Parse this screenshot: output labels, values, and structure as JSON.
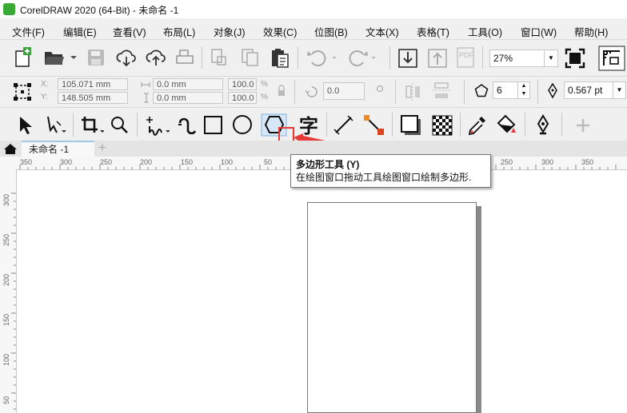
{
  "window": {
    "title": "CorelDRAW 2020 (64-Bit) - 未命名 -1"
  },
  "menu": [
    "文件(F)",
    "编辑(E)",
    "查看(V)",
    "布局(L)",
    "对象(J)",
    "效果(C)",
    "位图(B)",
    "文本(X)",
    "表格(T)",
    "工具(O)",
    "窗口(W)",
    "帮助(H)"
  ],
  "toolbar": {
    "zoom": "27%"
  },
  "property_bar": {
    "x_label": "X:",
    "y_label": "Y:",
    "x_value": "105.071 mm",
    "y_value": "148.505 mm",
    "width_value": "0.0 mm",
    "height_value": "0.0 mm",
    "scale_w": "100.0",
    "scale_h": "100.0",
    "scale_unit": "%",
    "rotation": "0.0",
    "sides": "6",
    "outline_width": "0.567 pt"
  },
  "document_tab": {
    "label": "未命名 -1",
    "add_symbol": "+"
  },
  "ruler": {
    "h_labels": [
      "350",
      "300",
      "250",
      "200",
      "150",
      "100",
      "50",
      "250",
      "300",
      "350"
    ],
    "v_labels": [
      "300",
      "250",
      "200",
      "150",
      "100",
      "50"
    ]
  },
  "tooltip": {
    "title": "多边形工具 (Y)",
    "description": "在绘图窗口拖动工具绘图窗口绘制多边形."
  },
  "colors": {
    "highlight": "#e53935",
    "logo": "#39a935",
    "accent_tab": "#a0c8e8"
  }
}
